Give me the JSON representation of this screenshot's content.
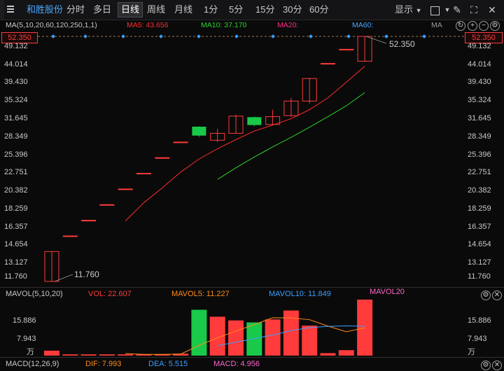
{
  "toolbar": {
    "stock_name": "和胜股份",
    "periods": [
      "分时",
      "多日",
      "日线",
      "周线",
      "月线",
      "1分",
      "5分",
      "15分",
      "30分",
      "60分"
    ],
    "active_period": "日线",
    "display_label": "显示"
  },
  "main_pane": {
    "indicator_label": "MA(5,10,20,60,120,250,1,1)",
    "ma5": "MA5: 43.656",
    "ma10": "MA10: 37.170",
    "ma20": "MA20:",
    "ma60": "MA60:",
    "ma_overflow": "MA",
    "current_price_tag_left": "52.350",
    "current_price_tag_right": "52.350",
    "high_label": "52.350",
    "low_label": "11.760",
    "price_ticks": [
      "49.132",
      "44.014",
      "39.430",
      "35.324",
      "31.645",
      "28.349",
      "25.396",
      "22.751",
      "20.382",
      "18.259",
      "16.357",
      "14.654",
      "13.127",
      "11.760"
    ]
  },
  "volume_pane": {
    "indicator_label": "MAVOL(5,10,20)",
    "vol": "VOL: 22.607",
    "mavol5": "MAVOL5: 11.227",
    "mavol10": "MAVOL10: 11.849",
    "mavol20": "MAVOL20",
    "ticks": [
      "15.886",
      "7.943"
    ],
    "unit": "万"
  },
  "macd_pane": {
    "indicator_label": "MACD(12,26,9)",
    "dif": "DIF: 7.993",
    "dea": "DEA: 5.515",
    "macd": "MACD: 4.956"
  },
  "colors": {
    "up": "#ff3b3b",
    "down": "#19c94a",
    "ma5": "#ff2a2a",
    "ma10": "#2bd22b",
    "ma20": "#ff2a8a",
    "ma60": "#4aa8ff",
    "mavol5": "#ff8c1a",
    "mavol10": "#3aa0ff",
    "mavol20": "#ff66cc"
  },
  "chart_data": {
    "type": "candlestick",
    "candles": [
      {
        "open": 11.76,
        "high": 14.11,
        "low": 11.76,
        "close": 14.11,
        "volume": 2.0
      },
      {
        "open": 15.52,
        "high": 15.52,
        "low": 15.52,
        "close": 15.52,
        "volume": 0.5
      },
      {
        "open": 17.07,
        "high": 17.07,
        "low": 17.07,
        "close": 17.07,
        "volume": 0.5
      },
      {
        "open": 18.78,
        "high": 18.78,
        "low": 18.78,
        "close": 18.78,
        "volume": 0.5
      },
      {
        "open": 20.66,
        "high": 20.66,
        "low": 20.66,
        "close": 20.66,
        "volume": 0.5
      },
      {
        "open": 22.73,
        "high": 22.73,
        "low": 22.73,
        "close": 22.73,
        "volume": 0.5
      },
      {
        "open": 25.0,
        "high": 25.0,
        "low": 25.0,
        "close": 25.0,
        "volume": 0.5
      },
      {
        "open": 27.5,
        "high": 27.5,
        "low": 27.5,
        "close": 27.5,
        "volume": 0.8
      },
      {
        "open": 30.2,
        "high": 30.25,
        "low": 28.4,
        "close": 28.6,
        "volume": 18.5
      },
      {
        "open": 27.8,
        "high": 29.8,
        "low": 27.5,
        "close": 29.0,
        "volume": 15.7
      },
      {
        "open": 29.0,
        "high": 32.5,
        "low": 29.0,
        "close": 32.2,
        "volume": 14.2
      },
      {
        "open": 32.0,
        "high": 32.1,
        "low": 30.3,
        "close": 30.5,
        "volume": 13.4
      },
      {
        "open": 30.6,
        "high": 33.5,
        "low": 30.6,
        "close": 32.1,
        "volume": 14.6
      },
      {
        "open": 32.3,
        "high": 36.0,
        "low": 32.1,
        "close": 35.3,
        "volume": 18.2
      },
      {
        "open": 35.3,
        "high": 40.6,
        "low": 34.8,
        "close": 40.5,
        "volume": 12.1
      },
      {
        "open": 44.4,
        "high": 44.4,
        "low": 44.4,
        "close": 44.4,
        "volume": 1.0
      },
      {
        "open": 48.4,
        "high": 48.4,
        "low": 48.4,
        "close": 48.4,
        "volume": 2.2
      },
      {
        "open": 45.0,
        "high": 52.35,
        "low": 45.0,
        "close": 52.35,
        "volume": 22.607
      }
    ],
    "ma5": [
      null,
      null,
      null,
      null,
      17.0,
      19.0,
      20.8,
      22.9,
      24.8,
      26.4,
      27.9,
      29.4,
      30.5,
      31.7,
      33.5,
      36.0,
      39.6,
      43.656
    ],
    "ma10": [
      null,
      null,
      null,
      null,
      null,
      null,
      null,
      null,
      null,
      21.9,
      23.5,
      25.1,
      26.7,
      28.3,
      30.1,
      32.1,
      34.3,
      37.17
    ],
    "mavol5": [
      null,
      null,
      null,
      null,
      0.8,
      0.5,
      0.5,
      0.6,
      4.1,
      7.2,
      9.9,
      12.5,
      15.3,
      15.2,
      14.5,
      11.9,
      9.6,
      11.227
    ],
    "mavol10": [
      null,
      null,
      null,
      null,
      null,
      null,
      null,
      null,
      null,
      4.0,
      5.4,
      6.9,
      8.3,
      10.1,
      11.3,
      11.8,
      12.0,
      11.849
    ],
    "price_range": [
      11.76,
      52.35
    ],
    "volume_range": [
      0,
      22.607
    ],
    "scale": "log"
  }
}
